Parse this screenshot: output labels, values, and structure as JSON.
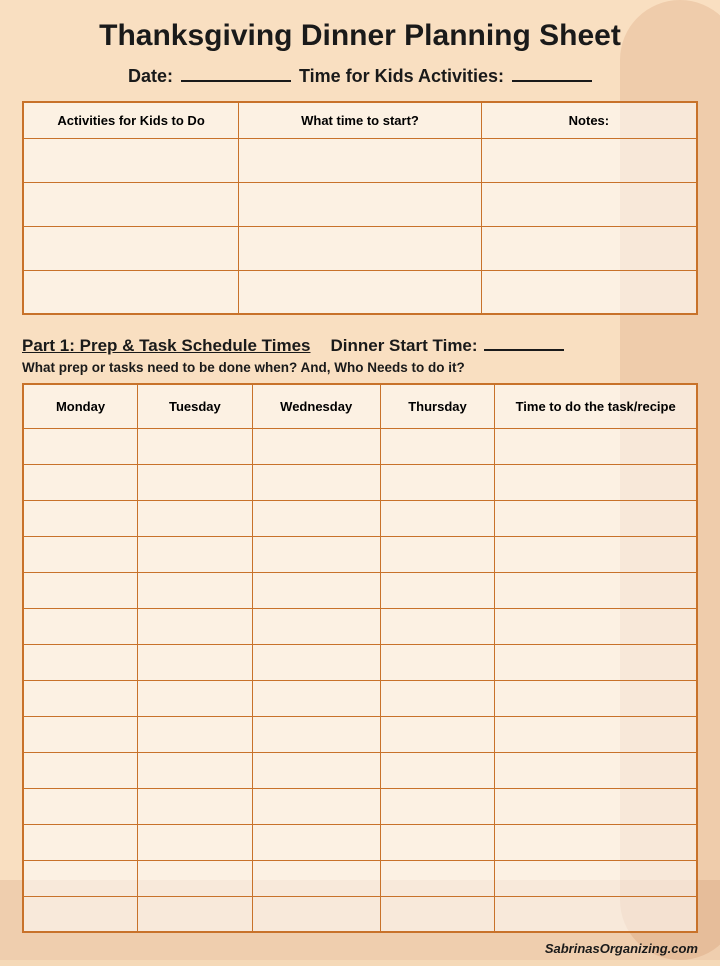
{
  "page": {
    "title": "Thanksgiving Dinner Planning Sheet",
    "date_label": "Date:",
    "time_label": "Time for Kids Activities:",
    "date_value": "",
    "time_value": ""
  },
  "activities_table": {
    "columns": [
      "Activities for Kids to Do",
      "What time to start?",
      "Notes:"
    ],
    "rows": 4
  },
  "section1": {
    "title": "Part 1: Prep & Task Schedule Times",
    "dinner_start_label": "Dinner Start Time:",
    "dinner_start_value": "",
    "subtitle": "What prep or tasks need to be done when? And, Who Needs to do it?",
    "columns": [
      "Monday",
      "Tuesday",
      "Wednesday",
      "Thursday",
      "Time to do the task/recipe"
    ],
    "rows": 14
  },
  "footer": {
    "website": "SabrinasOrganizing.com"
  }
}
